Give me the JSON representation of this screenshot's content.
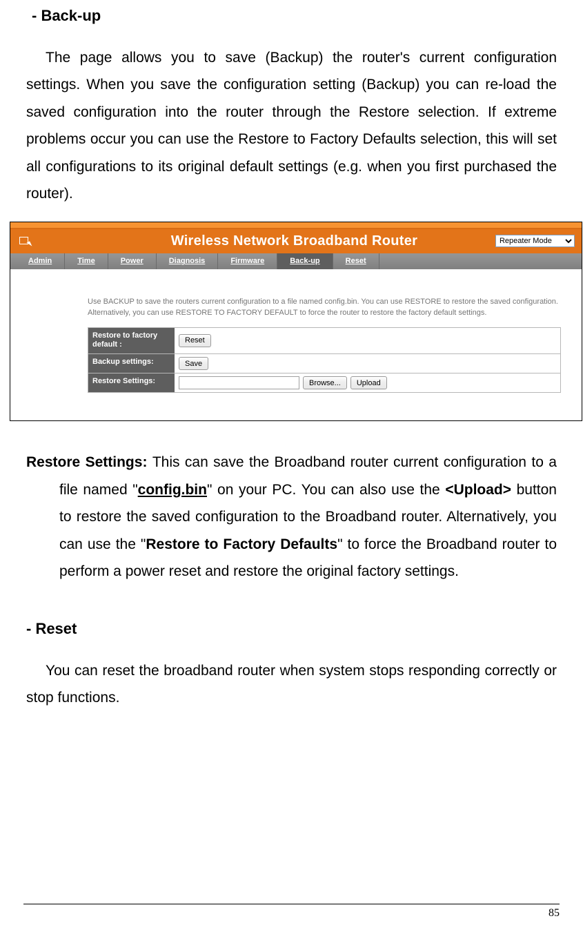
{
  "doc": {
    "heading_backup": "- Back-up",
    "para_backup": "The page allows you to save (Backup) the router's current configuration settings. When you save the configuration setting (Backup) you can re-load the saved configuration into the router through the Restore selection. If extreme problems occur you can use the Restore to Factory Defaults selection, this will set all configurations to its original default settings (e.g. when you first purchased the router).",
    "restore_label": "Restore Settings: ",
    "restore_seg1": "This can save the Broadband router current configuration to a file named \"",
    "restore_configbin": "config.bin",
    "restore_seg2": "\" on your PC. You can also use the ",
    "restore_upload": "<Upload>",
    "restore_seg3": " button to restore the saved configuration to the Broadband router. Alternatively, you can use the \"",
    "restore_factory": "Restore to Factory Defaults",
    "restore_seg4": "\" to force the Broadband router to perform a power reset and restore the original factory settings.",
    "heading_reset": "- Reset",
    "para_reset": "You can reset the broadband router when system stops responding correctly or stop functions.",
    "page_number": "85"
  },
  "router": {
    "title": "Wireless Network Broadband Router",
    "mode_selected": "Repeater Mode",
    "tabs": {
      "admin": "Admin",
      "time": "Time",
      "power": "Power",
      "diagnosis": "Diagnosis",
      "firmware": "Firmware",
      "backup": "Back-up",
      "reset": "Reset"
    },
    "intro": "Use BACKUP to save the routers current configuration to a file named config.bin. You can use RESTORE to restore the saved configuration. Alternatively, you can use RESTORE TO FACTORY DEFAULT to force the router to restore the factory default settings.",
    "rows": {
      "factory_label": "Restore to factory default :",
      "factory_btn": "Reset",
      "backup_label": "Backup settings:",
      "backup_btn": "Save",
      "restore_label": "Restore Settings:",
      "restore_browse": "Browse...",
      "restore_upload": "Upload"
    }
  }
}
